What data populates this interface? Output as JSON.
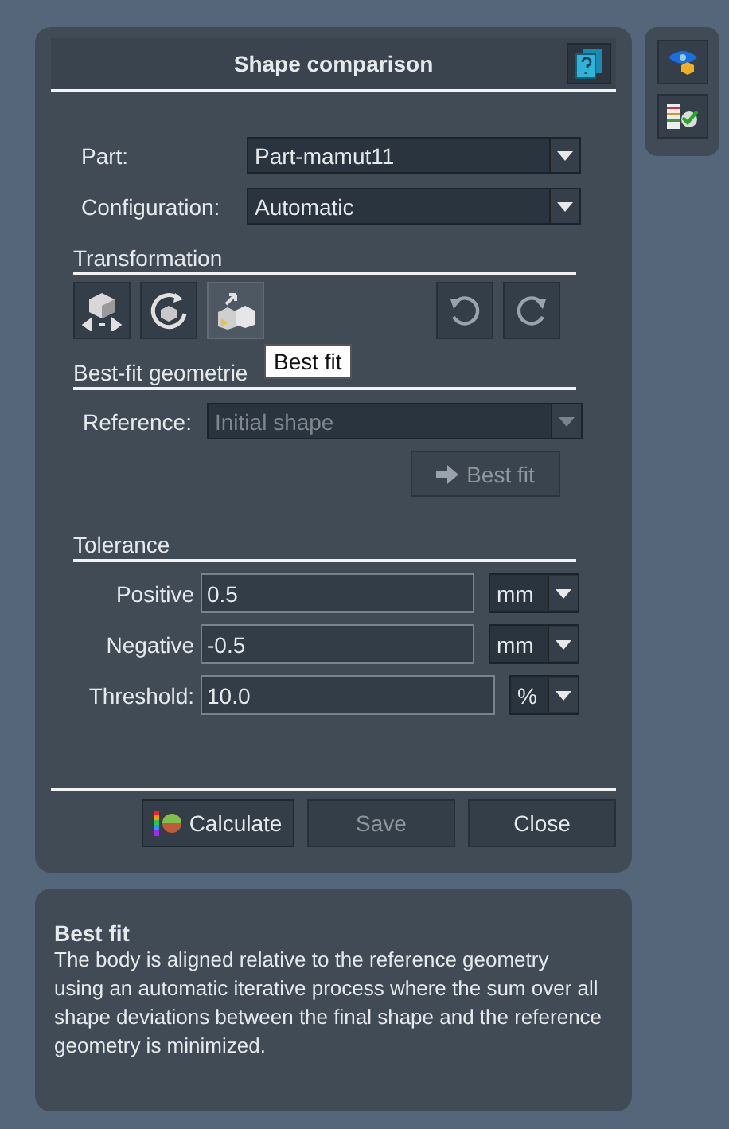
{
  "dialog": {
    "title": "Shape comparison"
  },
  "side_tools": [
    {
      "kind": "view"
    },
    {
      "kind": "check"
    }
  ],
  "fields": [
    {
      "label": "Part:",
      "value": "Part-mamut11"
    },
    {
      "label": "Configuration:",
      "value": "Automatic"
    }
  ],
  "transformation": {
    "heading": "Transformation",
    "tools": [
      {
        "kind": "move",
        "selected": false
      },
      {
        "kind": "rotate",
        "selected": false
      },
      {
        "kind": "bestfit",
        "selected": true
      }
    ],
    "tooltip": "Best fit"
  },
  "best_fit": {
    "heading": "Best-fit geometrie",
    "reference_label": "Reference:",
    "reference_value": "Initial shape",
    "disabled": true,
    "button": "Best fit"
  },
  "tolerance": {
    "heading": "Tolerance",
    "rows": [
      {
        "label": "Positive",
        "value": "0.5",
        "unit": "mm"
      },
      {
        "label": "Negative",
        "value": "-0.5",
        "unit": "mm"
      },
      {
        "label": "Threshold:",
        "value": "10.0",
        "unit": "%"
      }
    ]
  },
  "buttons": [
    {
      "kind": "calculate",
      "label": "Calculate",
      "disabled": false
    },
    {
      "kind": "save",
      "label": "Save",
      "disabled": true
    },
    {
      "kind": "close",
      "label": "Close",
      "disabled": false
    }
  ],
  "help": {
    "title": "Best fit",
    "text": "The body is aligned relative to the reference geometry using an automatic iterative process where the sum over all shape deviations between the final shape and the reference geometry is minimized."
  }
}
